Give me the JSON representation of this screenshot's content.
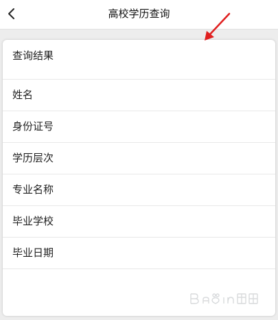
{
  "header": {
    "title": "高校学历查询",
    "back_icon": "chevron-left-icon"
  },
  "card": {
    "title": "查询结果",
    "rows": [
      {
        "label": "姓名"
      },
      {
        "label": "身份证号"
      },
      {
        "label": "学历层次"
      },
      {
        "label": "专业名称"
      },
      {
        "label": "毕业学校"
      },
      {
        "label": "毕业日期"
      }
    ]
  },
  "overlays": {
    "annotation_arrow_color": "#e02020",
    "watermark_name": "baidu-jingyan-watermark"
  },
  "colors": {
    "background": "#ededed",
    "surface": "#ffffff",
    "text": "#1f1f1f",
    "divider": "#e8e8e8"
  }
}
